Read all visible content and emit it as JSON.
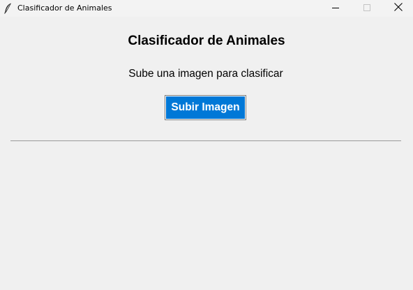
{
  "window": {
    "title": "Clasificador de Animales",
    "controls": [
      "minimize",
      "maximize",
      "close"
    ]
  },
  "main": {
    "heading": "Clasificador de Animales",
    "subtitle": "Sube una imagen para clasificar",
    "upload_button_label": "Subir Imagen"
  },
  "colors": {
    "button_bg": "#0078d7",
    "button_text": "#ffffff",
    "background": "#f0f0f0"
  },
  "icons": {
    "app": "feather-icon",
    "minimize": "minimize-icon",
    "maximize": "maximize-icon",
    "close": "close-icon"
  }
}
